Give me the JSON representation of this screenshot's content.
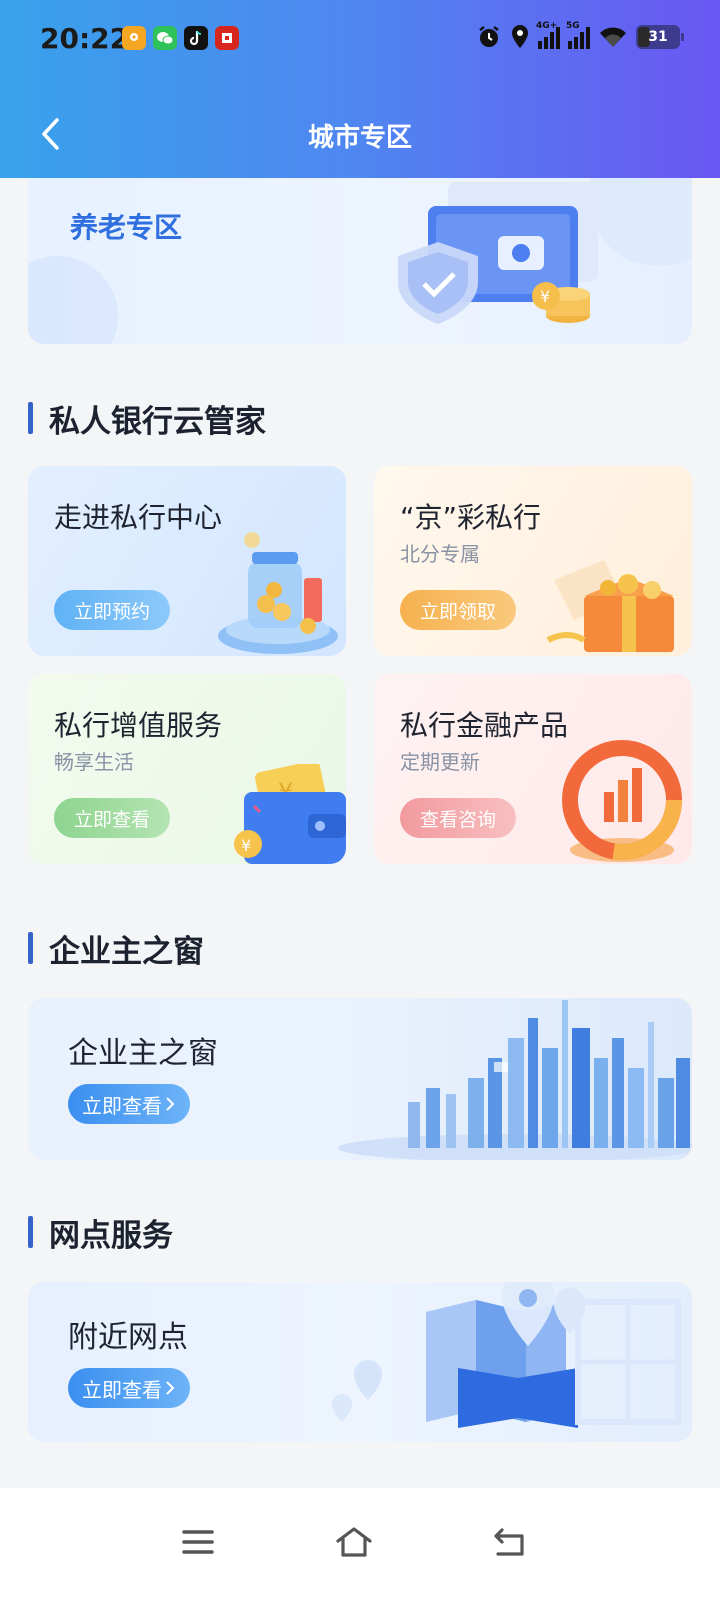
{
  "status_bar": {
    "time": "20:22",
    "network_1": "4G+",
    "network_2": "5G",
    "battery": "31"
  },
  "nav": {
    "title": "城市专区"
  },
  "elderly_banner": {
    "title": "养老专区"
  },
  "private_bank": {
    "section_title": "私人银行云管家",
    "cards": [
      {
        "title": "走进私行中心",
        "subtitle": "",
        "button": "立即预约"
      },
      {
        "title": "“京”彩私行",
        "subtitle": "北分专属",
        "button": "立即领取"
      },
      {
        "title": "私行增值服务",
        "subtitle": "畅享生活",
        "button": "立即查看"
      },
      {
        "title": "私行金融产品",
        "subtitle": "定期更新",
        "button": "查看咨询"
      }
    ]
  },
  "business": {
    "section_title": "企业主之窗",
    "banner_title": "企业主之窗",
    "button": "立即查看"
  },
  "branch": {
    "section_title": "网点服务",
    "banner_title": "附近网点",
    "button": "立即查看"
  },
  "colors": {
    "header_start": "#38a2ec",
    "header_end": "#6a57f3",
    "section_marker": "#3563c9",
    "elderly_title": "#2f6fe0"
  }
}
